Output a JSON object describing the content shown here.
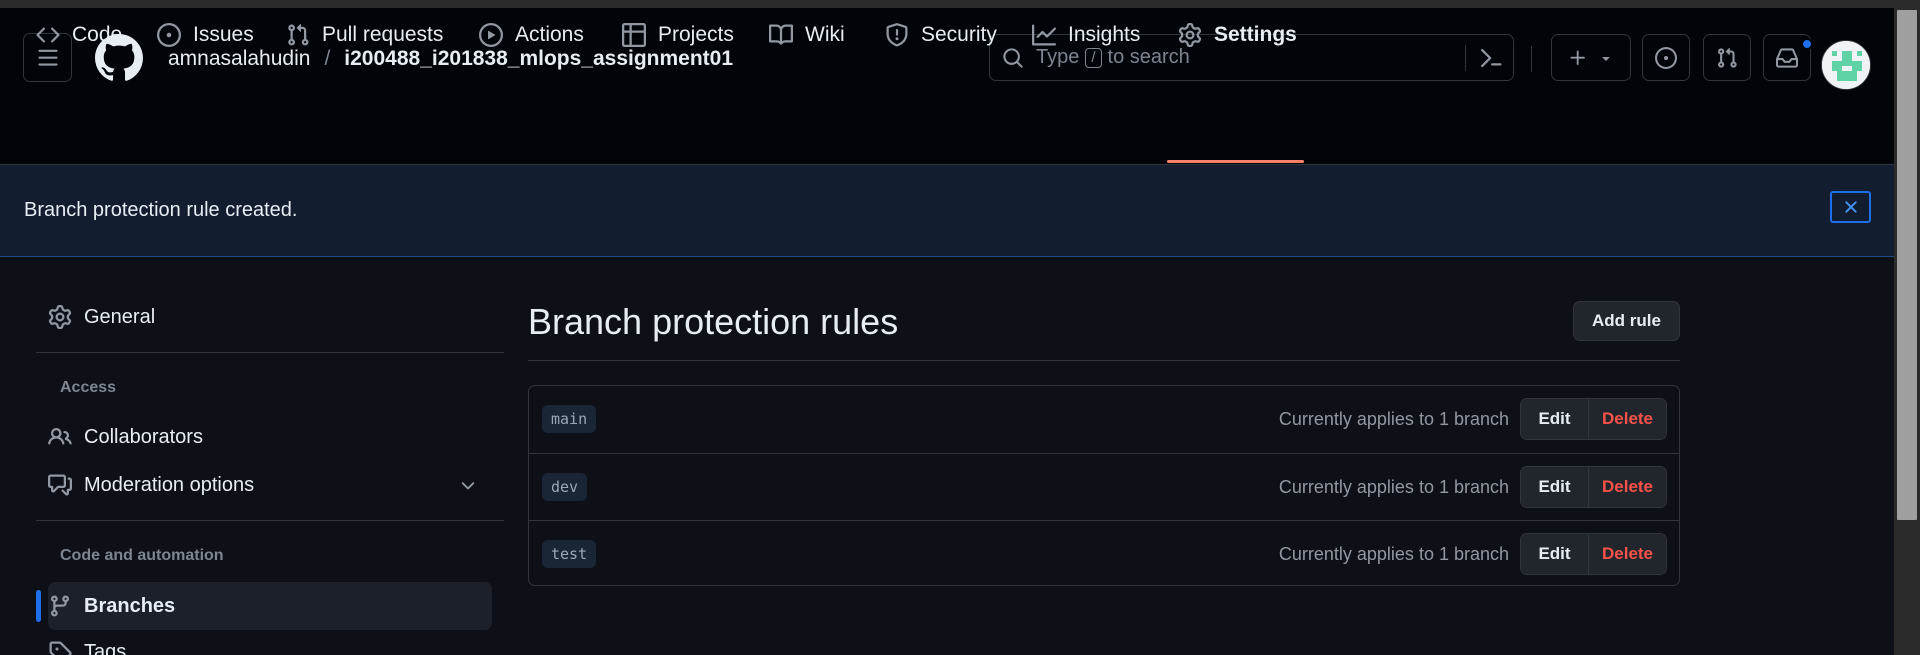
{
  "header": {
    "owner": "amnasalahudin",
    "separator": "/",
    "repo": "i200488_i201838_mlops_assignment01",
    "search": {
      "prefix": "Type",
      "key": "/",
      "suffix": "to search"
    }
  },
  "tabs": [
    {
      "label": "Code",
      "icon": "code-icon"
    },
    {
      "label": "Issues",
      "icon": "issue-opened-icon"
    },
    {
      "label": "Pull requests",
      "icon": "git-pull-request-icon"
    },
    {
      "label": "Actions",
      "icon": "play-icon"
    },
    {
      "label": "Projects",
      "icon": "table-icon"
    },
    {
      "label": "Wiki",
      "icon": "book-icon"
    },
    {
      "label": "Security",
      "icon": "shield-icon"
    },
    {
      "label": "Insights",
      "icon": "graph-icon"
    },
    {
      "label": "Settings",
      "icon": "gear-icon",
      "active": true
    }
  ],
  "flash": {
    "message": "Branch protection rule created."
  },
  "sidebar": {
    "general": "General",
    "access_heading": "Access",
    "collaborators": "Collaborators",
    "moderation": "Moderation options",
    "code_heading": "Code and automation",
    "branches": "Branches",
    "tags": "Tags"
  },
  "main": {
    "title": "Branch protection rules",
    "add_rule": "Add rule",
    "rules": [
      {
        "branch": "main",
        "applies": "Currently applies to 1 branch",
        "edit": "Edit",
        "delete": "Delete"
      },
      {
        "branch": "dev",
        "applies": "Currently applies to 1 branch",
        "edit": "Edit",
        "delete": "Delete"
      },
      {
        "branch": "test",
        "applies": "Currently applies to 1 branch",
        "edit": "Edit",
        "delete": "Delete"
      }
    ]
  },
  "colors": {
    "background": "#0d1117",
    "header": "#010409",
    "accent": "#1f6feb",
    "active_tab": "#f78166",
    "danger": "#f85149"
  }
}
